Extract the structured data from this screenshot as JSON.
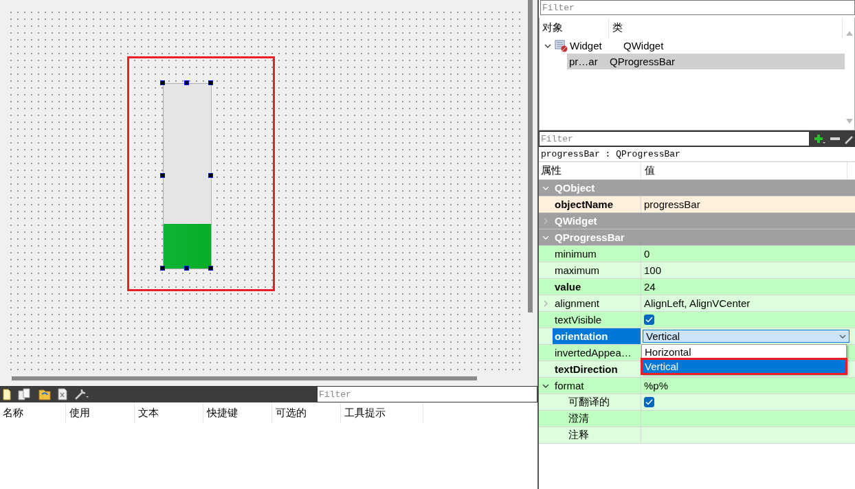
{
  "canvas": {
    "progress_bar": {
      "level": 0.24,
      "selected": true,
      "annotated": true
    }
  },
  "action_editor": {
    "filter": {
      "placeholder": "Filter"
    },
    "columns": [
      "名称",
      "使用",
      "文本",
      "快捷键",
      "可选的",
      "工具提示"
    ]
  },
  "object_inspector": {
    "filter": {
      "placeholder": "Filter"
    },
    "columns": [
      "对象",
      "类"
    ],
    "tree": [
      {
        "name": "Widget",
        "class": "QWidget",
        "expanded": true,
        "selected": false,
        "children": [
          {
            "name": "pr…ar",
            "class": "QProgressBar",
            "selected": true
          }
        ]
      }
    ]
  },
  "property_editor": {
    "filter": {
      "placeholder": "Filter"
    },
    "title": "progressBar : QProgressBar",
    "columns": [
      "属性",
      "值"
    ],
    "groups": [
      {
        "name": "QObject",
        "expanded": true,
        "color": "#fff0dc",
        "properties": [
          {
            "kind": "text",
            "name": "objectName",
            "value": "progressBar",
            "modified": true,
            "selected": false
          }
        ]
      },
      {
        "name": "QWidget",
        "expanded": false
      },
      {
        "name": "QProgressBar",
        "expanded": true,
        "color": "#bfffbf",
        "properties": [
          {
            "kind": "text",
            "name": "minimum",
            "value": "0",
            "modified": false,
            "selected": false
          },
          {
            "kind": "text",
            "name": "maximum",
            "value": "100",
            "modified": false,
            "selected": false
          },
          {
            "kind": "text",
            "name": "value",
            "value": "24",
            "modified": true,
            "selected": false
          },
          {
            "kind": "text",
            "name": "alignment",
            "value": "AlignLeft, AlignVCenter",
            "modified": false,
            "selected": false,
            "expanded": false
          },
          {
            "kind": "checkbox",
            "name": "textVisible",
            "checked": true,
            "modified": false,
            "selected": false
          },
          {
            "kind": "combo",
            "name": "orientation",
            "value": "Vertical",
            "modified": true,
            "selected": true,
            "open": true,
            "options": [
              {
                "label": "Horizontal",
                "selected": false,
                "annotated": false
              },
              {
                "label": "Vertical",
                "selected": true,
                "annotated": true
              }
            ]
          },
          {
            "kind": "text",
            "name": "invertedAppea…",
            "modified": false,
            "selected": false
          },
          {
            "kind": "text",
            "name": "textDirection",
            "modified": true,
            "selected": false
          },
          {
            "kind": "text",
            "name": "format",
            "value": "%p%",
            "modified": false,
            "selected": false,
            "expanded": true,
            "children": [
              {
                "kind": "checkbox",
                "name": "可翻译的",
                "checked": true,
                "modified": false,
                "selected": false
              },
              {
                "kind": "text",
                "name": "澄清",
                "modified": false,
                "selected": false
              },
              {
                "kind": "text",
                "name": "注释",
                "modified": false,
                "selected": false
              }
            ]
          }
        ]
      }
    ]
  }
}
